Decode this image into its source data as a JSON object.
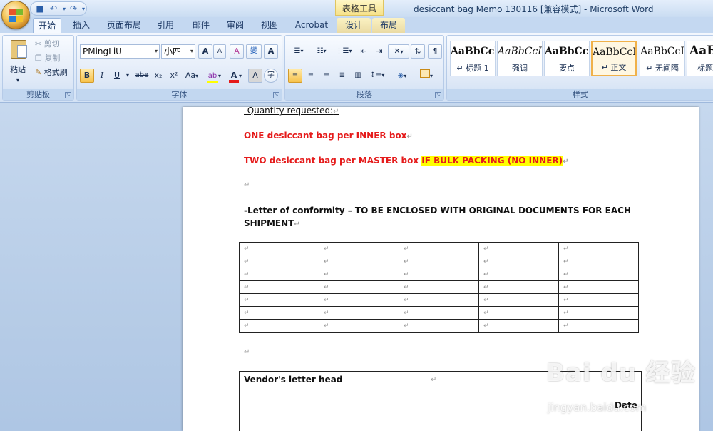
{
  "title_bar": {
    "context_tab_title": "表格工具",
    "window_title": "desiccant bag Memo 130116 [兼容模式] - Microsoft Word"
  },
  "tabs": [
    {
      "label": "开始",
      "active": true
    },
    {
      "label": "插入"
    },
    {
      "label": "页面布局"
    },
    {
      "label": "引用"
    },
    {
      "label": "邮件"
    },
    {
      "label": "审阅"
    },
    {
      "label": "视图"
    },
    {
      "label": "Acrobat"
    },
    {
      "label": "设计",
      "contextual": true
    },
    {
      "label": "布局",
      "contextual": true
    }
  ],
  "ribbon": {
    "clipboard": {
      "label": "剪贴板",
      "paste": "粘贴",
      "cut": "剪切",
      "copy": "复制",
      "format_painter": "格式刷"
    },
    "font": {
      "label": "字体",
      "font_name": "PMingLiU",
      "font_size": "小四",
      "bold": "B",
      "italic": "I",
      "underline": "U",
      "strikethrough": "abe",
      "subscript": "x₂",
      "superscript": "x²",
      "change_case": "Aa",
      "grow": "A",
      "shrink": "A",
      "clear": "A",
      "phonetic": "A",
      "enclose": "字"
    },
    "paragraph": {
      "label": "段落"
    },
    "styles": {
      "label": "样式",
      "items": [
        {
          "sample": "AaBbCcI",
          "name": "↵ 标题 1"
        },
        {
          "sample": "AaBbCcL",
          "name": "强调"
        },
        {
          "sample": "AaBbCcI",
          "name": "要点"
        },
        {
          "sample": "AaBbCcI",
          "name": "↵ 正文",
          "selected": true
        },
        {
          "sample": "AaBbCcI",
          "name": "↵ 无间隔"
        },
        {
          "sample": "AaB",
          "name": "标题"
        }
      ]
    }
  },
  "document": {
    "qty_heading": "-Quantity requested:",
    "line_one": "ONE desiccant bag per INNER box",
    "line_two_a": "TWO desiccant bag per MASTER box ",
    "line_two_highlight": "IF BULK PACKING (NO INNER)",
    "letter_line1": "-Letter of conformity – TO BE ENCLOSED WITH ORIGINAL DOCUMENTS FOR EACH",
    "letter_line2": "SHIPMENT",
    "table": {
      "rows": 7,
      "cols": 5
    },
    "vendor_head": "Vendor's letter head",
    "date_label": "Date",
    "paragraph_mark": "↵"
  },
  "watermark": {
    "text": "Bai du 经验",
    "sub": "jingyan.baidu.com"
  },
  "colors": {
    "red_text": "#e51b1b",
    "highlight": "#ffff00"
  }
}
